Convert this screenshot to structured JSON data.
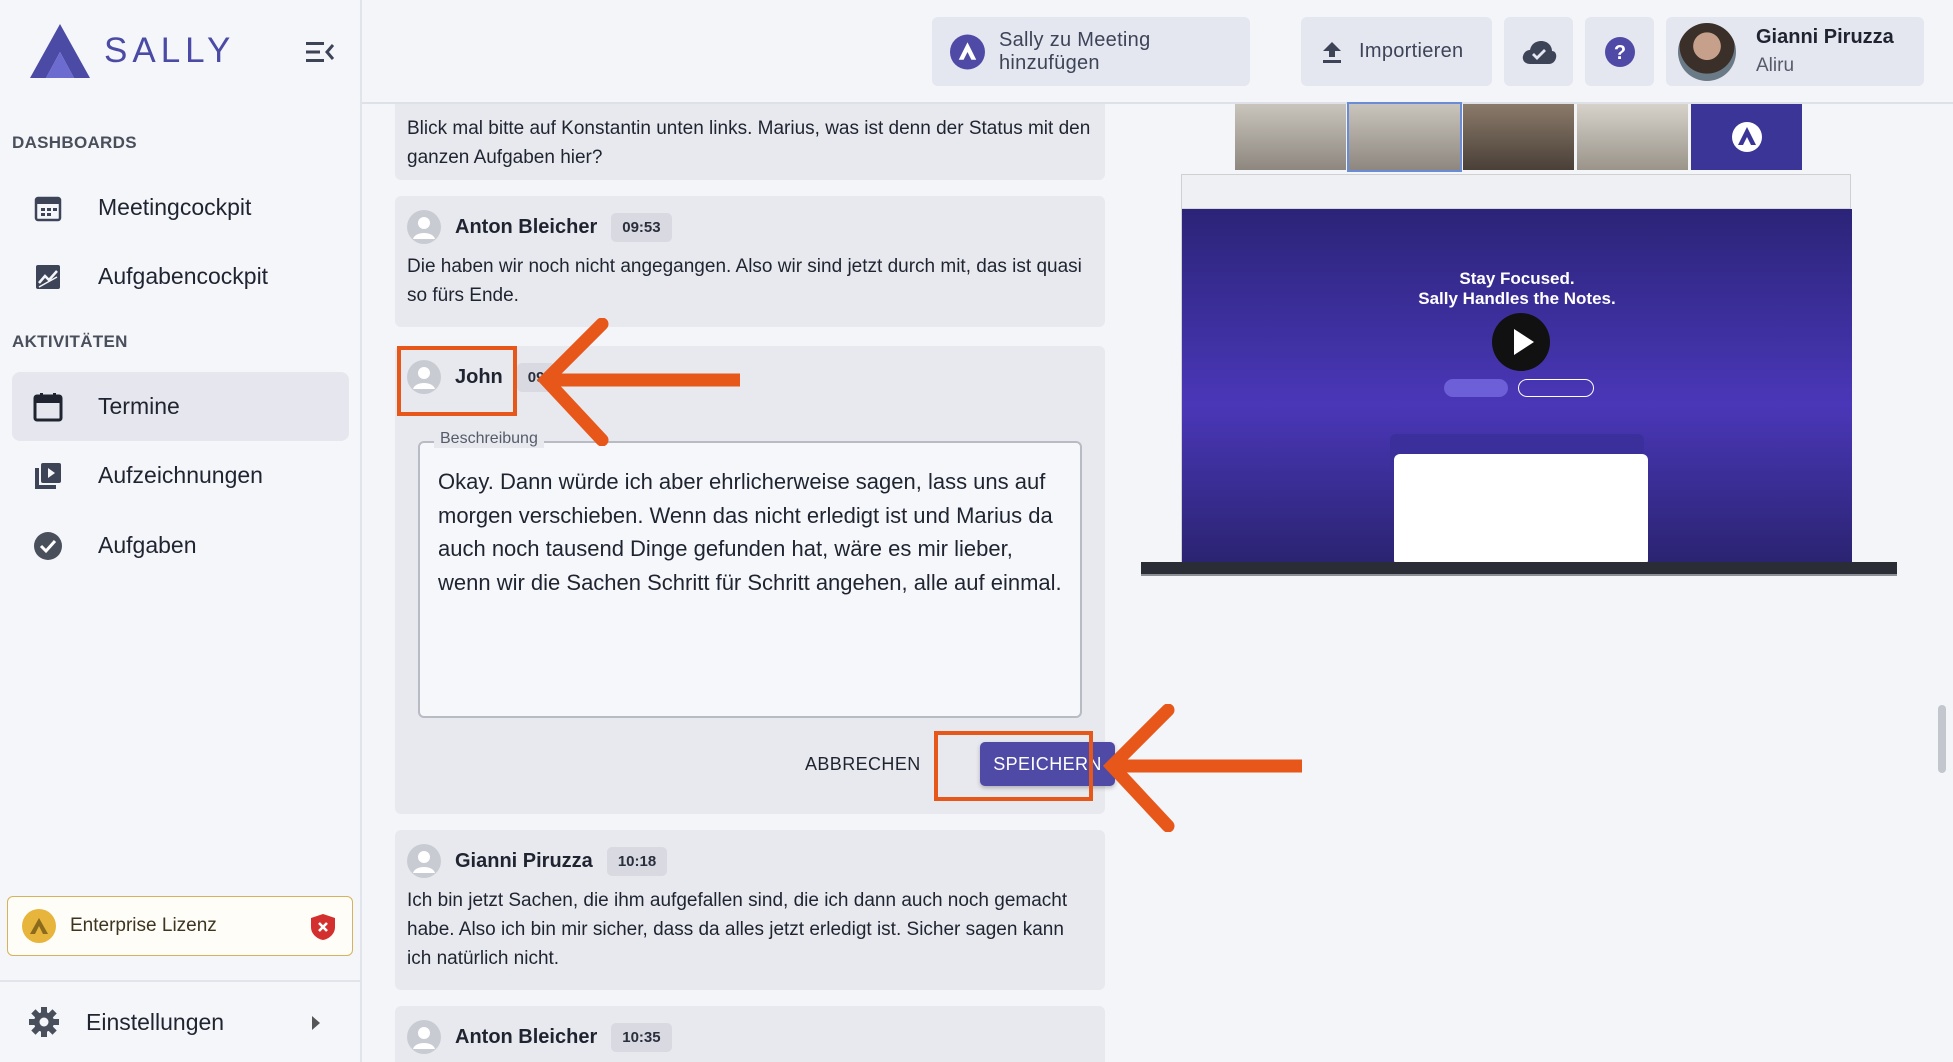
{
  "app": {
    "logo_text": "SALLY"
  },
  "sidebar": {
    "sections": [
      {
        "label": "DASHBOARDS"
      },
      {
        "label": "AKTIVITÄTEN"
      }
    ],
    "items": [
      {
        "label": "Meetingcockpit",
        "icon": "calendar-grid-icon"
      },
      {
        "label": "Aufgabencockpit",
        "icon": "chart-icon"
      },
      {
        "label": "Termine",
        "icon": "calendar-icon",
        "active": true
      },
      {
        "label": "Aufzeichnungen",
        "icon": "video-library-icon"
      },
      {
        "label": "Aufgaben",
        "icon": "check-circle-icon"
      }
    ],
    "license": {
      "label": "Enterprise Lizenz"
    },
    "settings": {
      "label": "Einstellungen"
    }
  },
  "topbar": {
    "add_to_meeting": "Sally zu Meeting hinzufügen",
    "import": "Importieren",
    "user": {
      "name": "Gianni Piruzza",
      "org": "Aliru"
    }
  },
  "transcript": {
    "entries": [
      {
        "text": "Blick mal bitte auf Konstantin unten links. Marius, was ist denn der Status mit den ganzen Aufgaben hier?"
      },
      {
        "speaker": "Anton Bleicher",
        "time": "09:53",
        "text": "Die haben wir noch nicht angegangen. Also wir sind jetzt durch mit, das ist quasi so fürs Ende."
      },
      {
        "speaker": "John",
        "time": "09",
        "editing": true
      },
      {
        "speaker": "Gianni Piruzza",
        "time": "10:18",
        "text": "Ich bin jetzt Sachen, die ihm aufgefallen sind, die ich dann auch noch gemacht habe. Also ich bin mir sicher, dass da alles jetzt erledigt ist. Sicher sagen kann ich natürlich nicht."
      },
      {
        "speaker": "Anton Bleicher",
        "time": "10:35"
      }
    ],
    "editor": {
      "legend": "Beschreibung",
      "value": "Okay. Dann würde ich aber ehrlicherweise sagen, lass uns auf morgen verschieben. Wenn das nicht erledigt ist und Marius da auch noch tausend Dinge gefunden hat, wäre es mir lieber, wenn wir die Sachen Schritt für Schritt angehen, alle auf einmal.",
      "cancel": "ABBRECHEN",
      "save": "SPEICHERN"
    }
  },
  "video": {
    "headline_1": "Stay Focused.",
    "headline_2": "Sally Handles the Notes."
  },
  "colors": {
    "accent": "#4f4aa6",
    "highlight": "#e8571a",
    "license_gold": "#e7b43c"
  }
}
